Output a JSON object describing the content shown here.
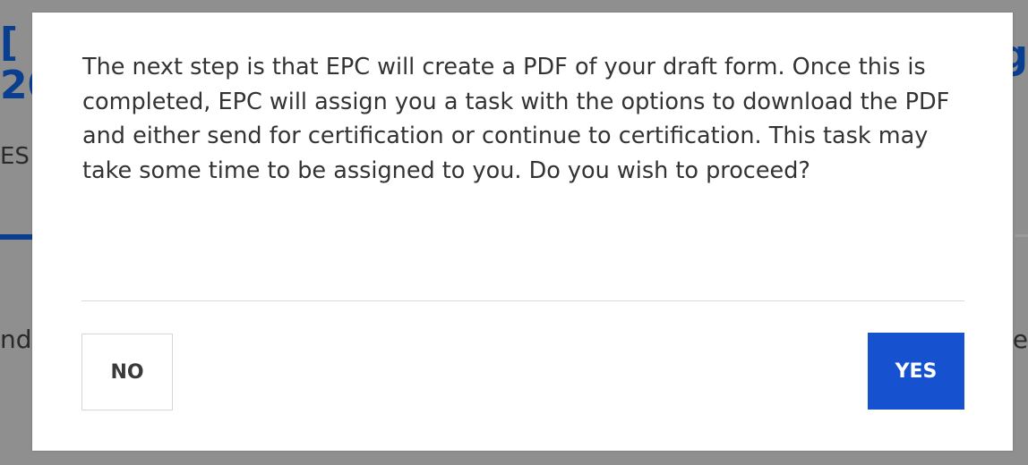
{
  "background": {
    "title_fragment_1": "[",
    "title_fragment_2": "20",
    "tab_fragment": "ES",
    "text_fragment_left": "nd",
    "title_fragment_right": "g",
    "text_fragment_right": "e"
  },
  "dialog": {
    "message": "The next step is that EPC will create a PDF of your draft form. Once this is completed, EPC will assign you a task with the options to download the PDF and either send for certification or continue to certification. This task may take some time to be assigned to you. Do you wish to proceed?",
    "no_label": "NO",
    "yes_label": "YES"
  },
  "colors": {
    "primary_button": "#1652cf",
    "overlay": "#8f8f8f",
    "background_title": "#0a3e8f"
  }
}
